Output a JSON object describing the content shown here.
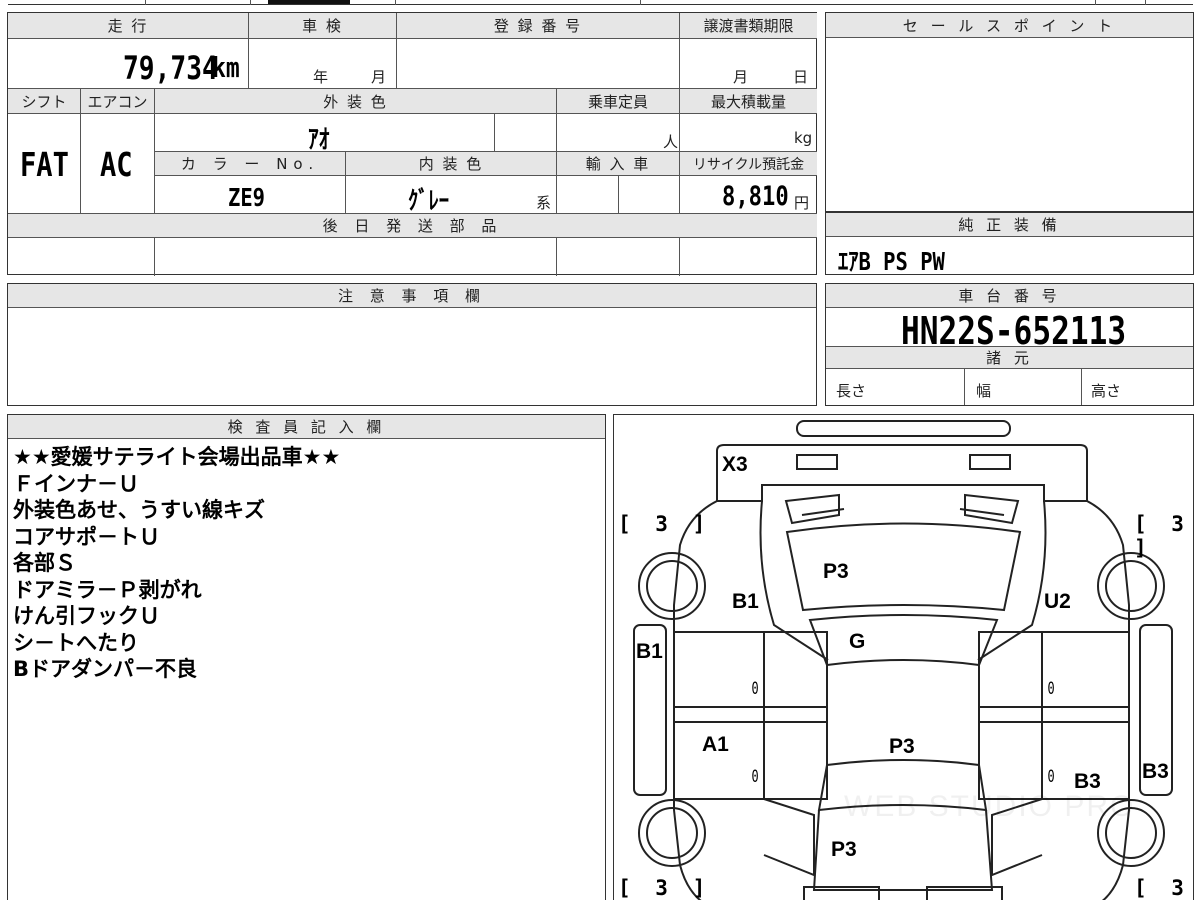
{
  "top_info": {
    "mileage_label": "走 行",
    "mileage_value": "79,734",
    "mileage_unit": "km",
    "shaken_label": "車 検",
    "shaken_year": "年",
    "shaken_month": "月",
    "registration_label": "登 録 番 号",
    "transfer_deadline_label": "譲渡書類期限",
    "transfer_month": "月",
    "transfer_day": "日",
    "shift_label": "シフト",
    "shift_value": "FAT",
    "aircon_label": "エアコン",
    "aircon_value": "AC",
    "exterior_color_label": "外 装 色",
    "exterior_color_value": "ｱｵ",
    "capacity_label": "乗車定員",
    "capacity_unit": "人",
    "max_load_label": "最大積載量",
    "max_load_unit": "kg",
    "color_no_label": "カ ラ ー No.",
    "color_no_value": "ZE9",
    "interior_color_label": "内 装 色",
    "interior_color_value": "ｸﾞﾚｰ",
    "interior_color_suffix": "系",
    "import_label": "輸 入 車",
    "recycle_label": "リサイクル預託金",
    "recycle_value": "8,810",
    "recycle_unit": "円",
    "later_parts_label": "後 日 発 送 部 品"
  },
  "sales_point": {
    "label": "セ ー ル ス ポ イ ン ト"
  },
  "genuine_equipment": {
    "label": "純 正 装 備",
    "value": "ｴｱB PS PW"
  },
  "notes": {
    "label": "注 意 事 項 欄"
  },
  "chassis": {
    "label": "車 台 番 号",
    "value": "HN22S-652113",
    "spec_label": "諸 元",
    "length_label": "長さ",
    "width_label": "幅",
    "height_label": "高さ"
  },
  "inspector": {
    "label": "検 査 員 記 入 欄",
    "lines": [
      "★★愛媛サテライト会場出品車★★",
      "Ｆインナ－Ｕ",
      "外装色あせ、うすい線キズ",
      "コアサポ－トＵ",
      "各部Ｓ",
      "ドアミラ－Ｐ剥がれ",
      "けん引フックＵ",
      "シ－トへたり",
      "Bドアダンパ－不良"
    ]
  },
  "car_diagram": {
    "marks": {
      "rear": "X3",
      "tire_fl": "[ 3 ]",
      "tire_fr": "[ 3 ]",
      "tire_rl": "[ 3 ]",
      "tire_rr": "[ 3 ]",
      "windshield": "P3",
      "hood_left": "B1",
      "hood_right": "U2",
      "panel_g": "G",
      "fender_left": "B1",
      "door_left": "A1",
      "roof": "P3",
      "rear_right": "B3",
      "side_right": "B3",
      "trunk": "P3",
      "zero_1": "0",
      "zero_2": "0",
      "zero_3": "0",
      "zero_4": "0"
    },
    "watermark": "WEB STUDIO PRO"
  }
}
